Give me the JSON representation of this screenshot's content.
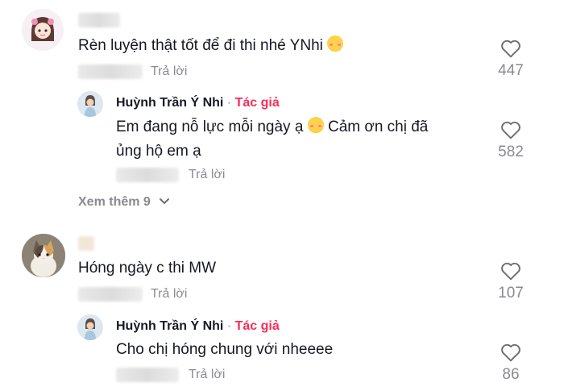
{
  "comments": [
    {
      "text": "Rèn luyện thật tốt để đi thi nhé YNhi",
      "emoji": "smiling-face-with-hearts",
      "reply_label": "Trả lời",
      "likes": "447",
      "reply": {
        "author": "Huỳnh Trần Ý Nhi",
        "separator": "·",
        "author_tag": "Tác giả",
        "text_line1_a": "Em đang nỗ lực mỗi ngày ạ",
        "text_line1_b": "Cảm ơn chị đã",
        "text_line2": "ủng hộ em ạ",
        "emoji": "smiling-face-with-hearts",
        "reply_label": "Trả lời",
        "likes": "582"
      },
      "view_more": "Xem thêm 9"
    },
    {
      "text": "Hóng ngày c thi MW",
      "reply_label": "Trả lời",
      "likes": "107",
      "reply": {
        "author": "Huỳnh Trần Ý Nhi",
        "separator": "·",
        "author_tag": "Tác giả",
        "text": "Cho chị hóng chung với nheeee",
        "reply_label": "Trả lời",
        "likes": "86"
      }
    }
  ],
  "colors": {
    "accent": "#fe2c55",
    "muted": "#8a8b91",
    "text": "#161823"
  },
  "icons": {
    "like": "heart-outline-icon",
    "expand": "chevron-down-icon"
  }
}
